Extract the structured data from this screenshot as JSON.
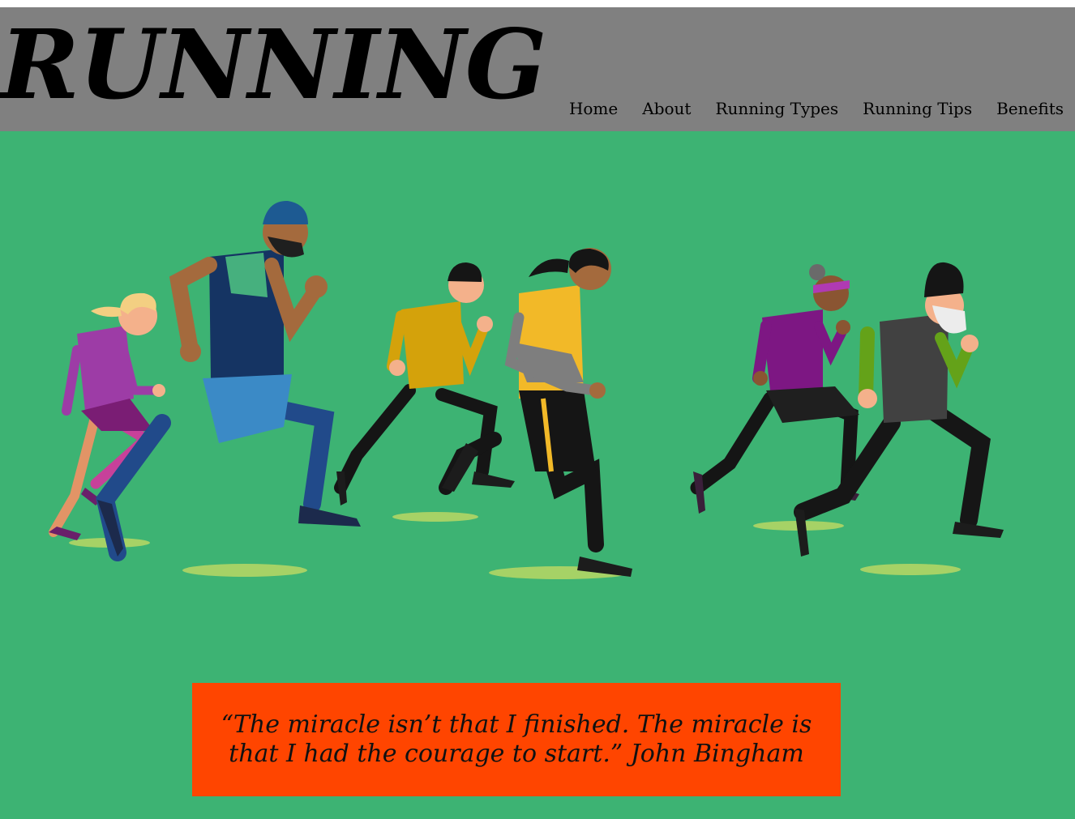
{
  "header": {
    "logo_text": "RUNNING",
    "nav": [
      "Home",
      "About",
      "Running Types",
      "Running Tips",
      "Benefits"
    ]
  },
  "hero": {
    "illustration": "group-of-runners-illustration"
  },
  "quote": {
    "text": "“The miracle isn’t that I finished. The miracle is that I had the courage to start.” John Bingham"
  },
  "colors": {
    "header_bg": "#808080",
    "hero_bg": "#3db373",
    "quote_bg": "#ff4500"
  }
}
